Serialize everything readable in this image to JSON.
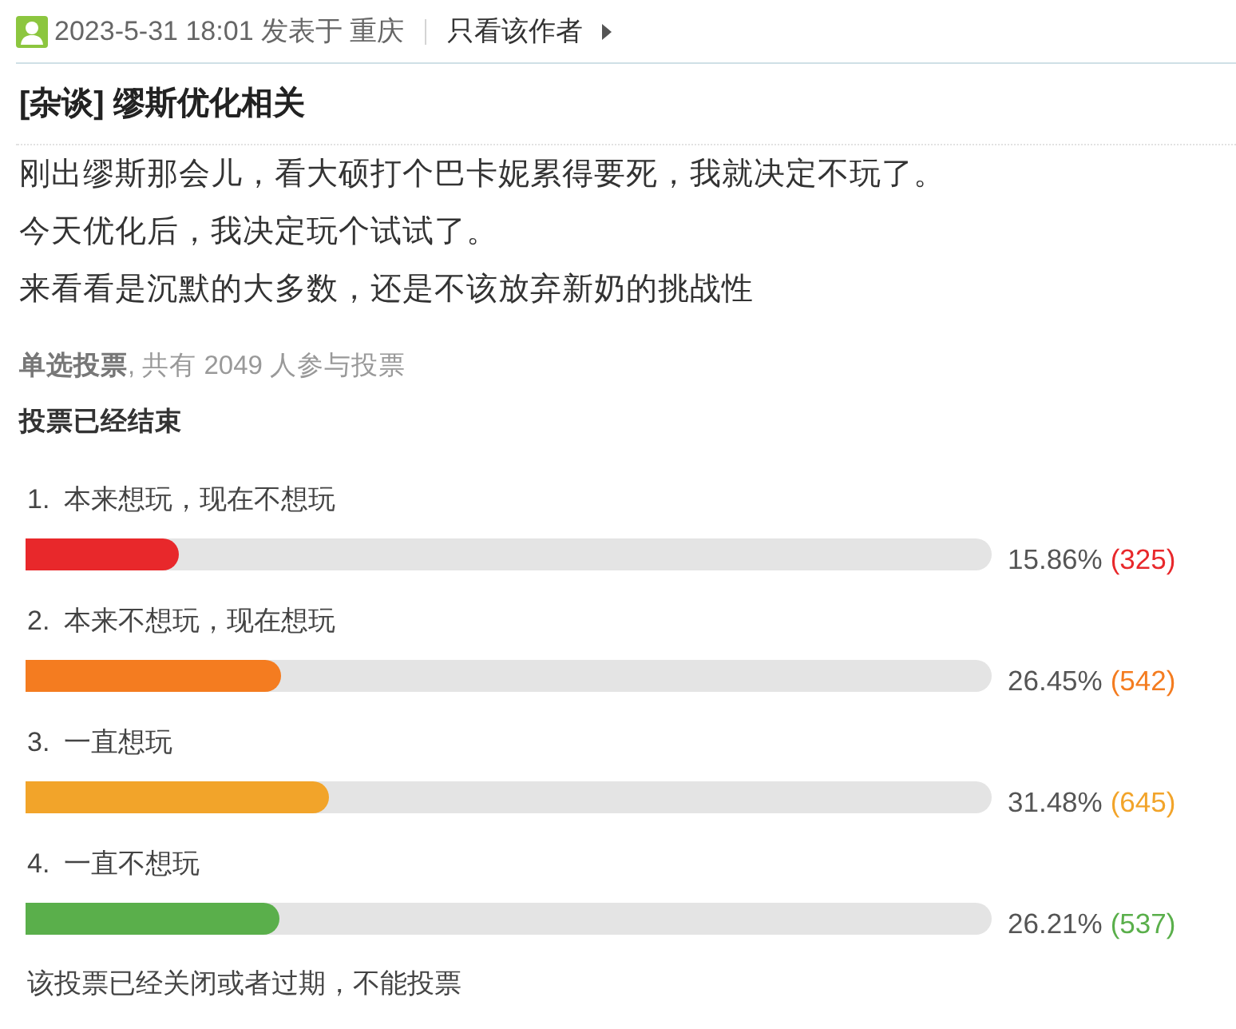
{
  "post_header": {
    "meta": "2023-5-31 18:01 发表于 重庆",
    "author_only_link": "只看该作者"
  },
  "title": "[杂谈] 缪斯优化相关",
  "body": [
    "刚出缪斯那会儿，看大硕打个巴卡妮累得要死，我就决定不玩了。",
    "今天优化后，我决定玩个试试了。",
    "来看看是沉默的大多数，还是不该放弃新奶的挑战性"
  ],
  "poll": {
    "summary": "**单选投票**, 共有 2049 人参与投票",
    "status": "投票已经结束",
    "options": [
      {
        "number": "1.",
        "label": "本来想玩，现在不想玩",
        "level": 0.1586,
        "percent": "15.86%",
        "count": "(325)",
        "color": "#e8282b"
      },
      {
        "number": "2.",
        "label": "本来不想玩，现在想玩",
        "level": 0.2645,
        "percent": "26.45%",
        "count": "(542)",
        "color": "#f47c20"
      },
      {
        "number": "3.",
        "label": "一直想玩",
        "level": 0.3148,
        "percent": "31.48%",
        "count": "(645)",
        "color": "#f2a42a"
      },
      {
        "number": "4.",
        "label": "一直不想玩",
        "level": 0.2621,
        "percent": "26.21%",
        "count": "(537)",
        "color": "#5aaf4b"
      }
    ],
    "closed_note": "该投票已经关闭或者过期，不能投票"
  }
}
